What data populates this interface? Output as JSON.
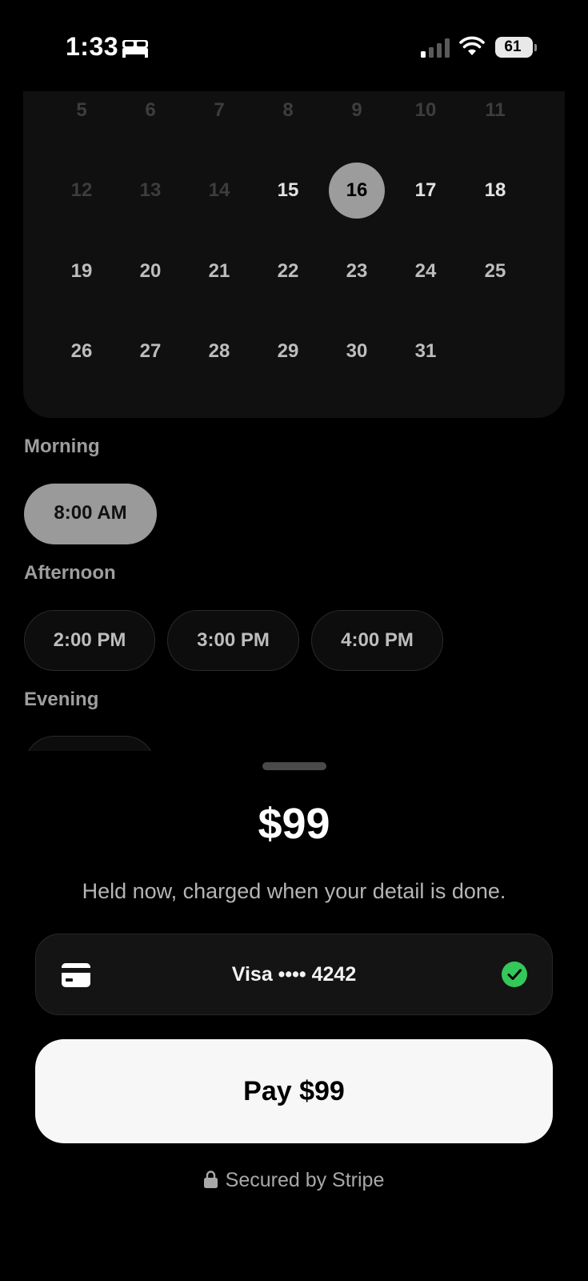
{
  "status_bar": {
    "time": "1:33",
    "battery": "61",
    "icons": [
      "bed-icon",
      "cellular-signal-icon",
      "wifi-icon",
      "battery-icon"
    ]
  },
  "calendar": {
    "weeks": [
      [
        {
          "d": "5",
          "s": "past"
        },
        {
          "d": "6",
          "s": "past"
        },
        {
          "d": "7",
          "s": "past"
        },
        {
          "d": "8",
          "s": "past"
        },
        {
          "d": "9",
          "s": "past"
        },
        {
          "d": "10",
          "s": "past"
        },
        {
          "d": "11",
          "s": "past"
        }
      ],
      [
        {
          "d": "12",
          "s": "past"
        },
        {
          "d": "13",
          "s": "past"
        },
        {
          "d": "14",
          "s": "past"
        },
        {
          "d": "15",
          "s": "strong"
        },
        {
          "d": "16",
          "s": "selected"
        },
        {
          "d": "17",
          "s": "strong"
        },
        {
          "d": "18",
          "s": "strong"
        }
      ],
      [
        {
          "d": "19",
          "s": "avail"
        },
        {
          "d": "20",
          "s": "avail"
        },
        {
          "d": "21",
          "s": "avail"
        },
        {
          "d": "22",
          "s": "avail"
        },
        {
          "d": "23",
          "s": "avail"
        },
        {
          "d": "24",
          "s": "avail"
        },
        {
          "d": "25",
          "s": "avail"
        }
      ],
      [
        {
          "d": "26",
          "s": "avail"
        },
        {
          "d": "27",
          "s": "avail"
        },
        {
          "d": "28",
          "s": "avail"
        },
        {
          "d": "29",
          "s": "avail"
        },
        {
          "d": "30",
          "s": "avail"
        },
        {
          "d": "31",
          "s": "avail"
        }
      ]
    ],
    "selected_date": "16"
  },
  "times": {
    "morning": {
      "label": "Morning",
      "slots": [
        "8:00 AM"
      ],
      "selected": "8:00 AM"
    },
    "afternoon": {
      "label": "Afternoon",
      "slots": [
        "2:00 PM",
        "3:00 PM",
        "4:00 PM"
      ]
    },
    "evening": {
      "label": "Evening"
    }
  },
  "sheet": {
    "price": "$99",
    "subtitle": "Held now, charged when your detail is done.",
    "card_label": "Visa •••• 4242",
    "pay_label": "Pay $99",
    "secured_text": "Secured by Stripe"
  },
  "colors": {
    "background": "#000000",
    "selected_pill": "#9a9a9a",
    "check_green": "#34c759",
    "pay_button": "#f7f7f7"
  }
}
